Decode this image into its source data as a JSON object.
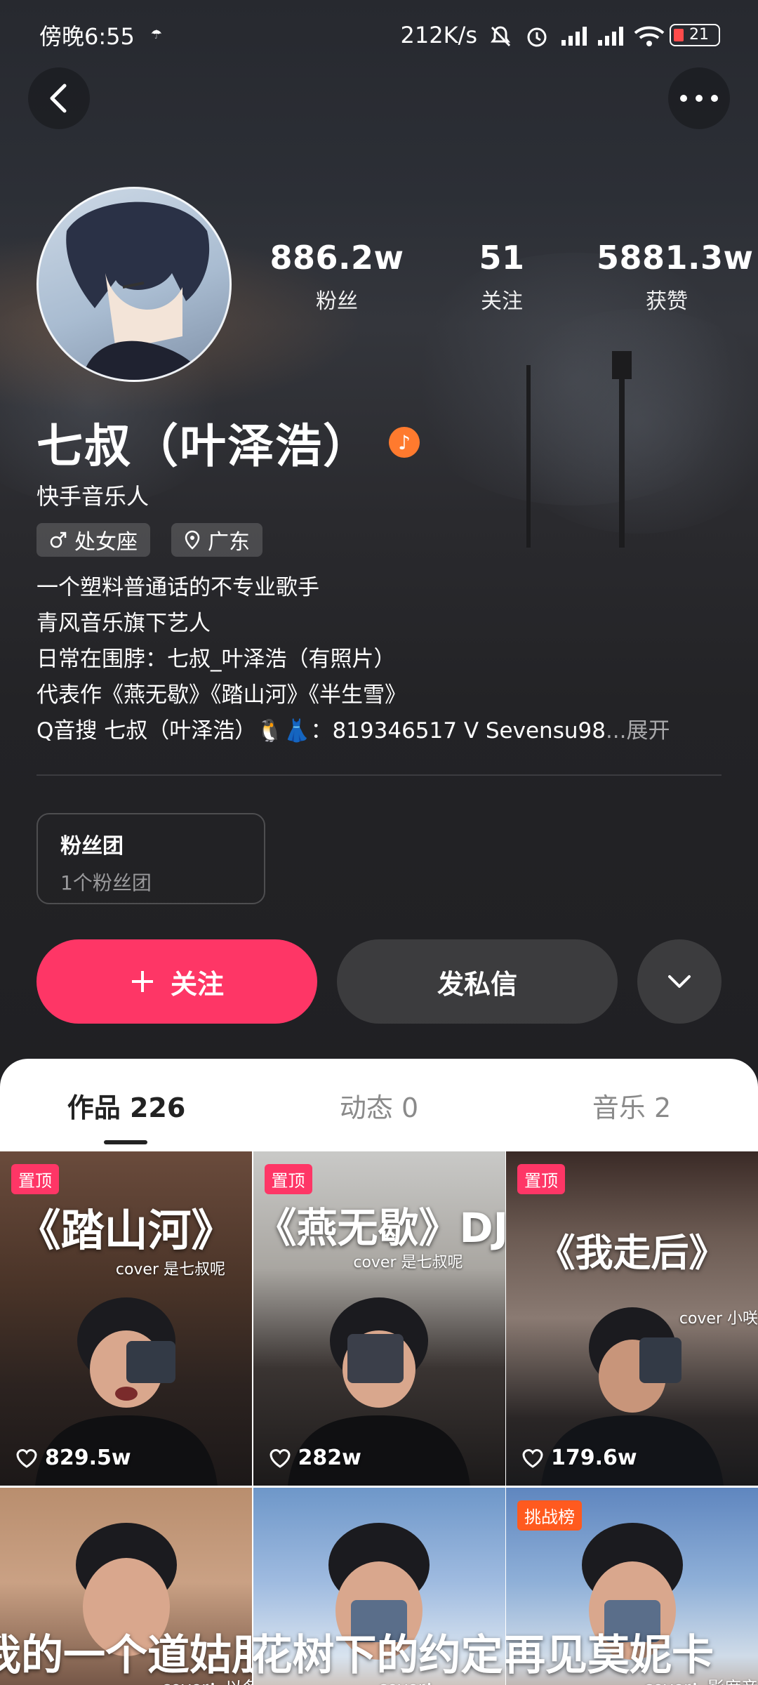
{
  "status_bar": {
    "time": "傍晚6:55",
    "speed": "212K/s",
    "battery": "21"
  },
  "profile": {
    "name": "七叔（叶泽浩）",
    "subtitle": "快手音乐人",
    "stats": [
      {
        "value": "886.2w",
        "label": "粉丝"
      },
      {
        "value": "51",
        "label": "关注"
      },
      {
        "value": "5881.3w",
        "label": "获赞"
      }
    ],
    "tags": [
      {
        "icon": "male-icon",
        "label": "处女座"
      },
      {
        "icon": "location-icon",
        "label": "广东"
      }
    ],
    "bio": [
      "一个塑料普通话的不专业歌手",
      "青风音乐旗下艺人",
      "日常在围脖：七叔_叶泽浩（有照片）",
      "代表作《燕无歇》《踏山河》《半生雪》",
      "Q音搜 七叔（叶泽浩）🐧👗：819346517 V Sevensu98"
    ],
    "bio_ellipsis": "...",
    "bio_expand": "展开"
  },
  "fan_club": {
    "title": "粉丝团",
    "subtitle": "1个粉丝团"
  },
  "actions": {
    "follow_label": "关注",
    "message_label": "发私信"
  },
  "tabs": [
    {
      "label": "作品 226",
      "active": true
    },
    {
      "label": "动态 0",
      "active": false
    },
    {
      "label": "音乐 2",
      "active": false
    }
  ],
  "videos": [
    {
      "badge": "置顶",
      "caption": "《踏山河》",
      "cover": "cover 是七叔呢",
      "likes": "829.5w"
    },
    {
      "badge": "置顶",
      "caption": "《燕无歇》DJ版",
      "cover": "cover 是七叔呢",
      "likes": "282w"
    },
    {
      "badge": "置顶",
      "caption": "《我走后》",
      "cover": "cover 小咲",
      "likes": "179.6w"
    },
    {
      "badge": "",
      "caption": "我的一个道姑朋友",
      "cover": "cover：以冬",
      "likes": ""
    },
    {
      "badge": "",
      "caption": "花树下的约定",
      "cover": "cover：",
      "likes": ""
    },
    {
      "badge": "挑战榜",
      "caption": "再见莫妮卡",
      "cover": "cover：影席彦",
      "likes": ""
    }
  ],
  "colors": {
    "accent": "#fe3666",
    "music_badge": "#ff7a2e",
    "challenge_badge": "#ff5a1f"
  }
}
